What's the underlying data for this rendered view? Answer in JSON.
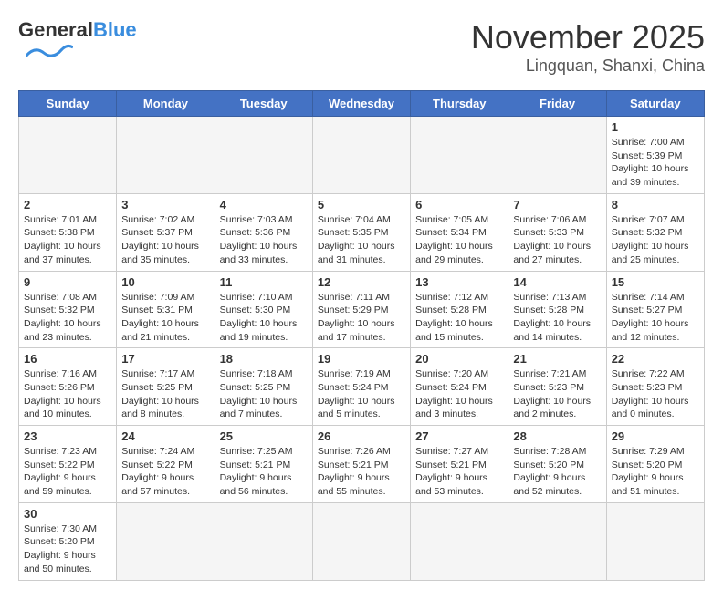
{
  "header": {
    "logo_general": "General",
    "logo_blue": "Blue",
    "month": "November 2025",
    "location": "Lingquan, Shanxi, China"
  },
  "weekdays": [
    "Sunday",
    "Monday",
    "Tuesday",
    "Wednesday",
    "Thursday",
    "Friday",
    "Saturday"
  ],
  "weeks": [
    [
      {
        "day": "",
        "info": ""
      },
      {
        "day": "",
        "info": ""
      },
      {
        "day": "",
        "info": ""
      },
      {
        "day": "",
        "info": ""
      },
      {
        "day": "",
        "info": ""
      },
      {
        "day": "",
        "info": ""
      },
      {
        "day": "1",
        "info": "Sunrise: 7:00 AM\nSunset: 5:39 PM\nDaylight: 10 hours and 39 minutes."
      }
    ],
    [
      {
        "day": "2",
        "info": "Sunrise: 7:01 AM\nSunset: 5:38 PM\nDaylight: 10 hours and 37 minutes."
      },
      {
        "day": "3",
        "info": "Sunrise: 7:02 AM\nSunset: 5:37 PM\nDaylight: 10 hours and 35 minutes."
      },
      {
        "day": "4",
        "info": "Sunrise: 7:03 AM\nSunset: 5:36 PM\nDaylight: 10 hours and 33 minutes."
      },
      {
        "day": "5",
        "info": "Sunrise: 7:04 AM\nSunset: 5:35 PM\nDaylight: 10 hours and 31 minutes."
      },
      {
        "day": "6",
        "info": "Sunrise: 7:05 AM\nSunset: 5:34 PM\nDaylight: 10 hours and 29 minutes."
      },
      {
        "day": "7",
        "info": "Sunrise: 7:06 AM\nSunset: 5:33 PM\nDaylight: 10 hours and 27 minutes."
      },
      {
        "day": "8",
        "info": "Sunrise: 7:07 AM\nSunset: 5:32 PM\nDaylight: 10 hours and 25 minutes."
      }
    ],
    [
      {
        "day": "9",
        "info": "Sunrise: 7:08 AM\nSunset: 5:32 PM\nDaylight: 10 hours and 23 minutes."
      },
      {
        "day": "10",
        "info": "Sunrise: 7:09 AM\nSunset: 5:31 PM\nDaylight: 10 hours and 21 minutes."
      },
      {
        "day": "11",
        "info": "Sunrise: 7:10 AM\nSunset: 5:30 PM\nDaylight: 10 hours and 19 minutes."
      },
      {
        "day": "12",
        "info": "Sunrise: 7:11 AM\nSunset: 5:29 PM\nDaylight: 10 hours and 17 minutes."
      },
      {
        "day": "13",
        "info": "Sunrise: 7:12 AM\nSunset: 5:28 PM\nDaylight: 10 hours and 15 minutes."
      },
      {
        "day": "14",
        "info": "Sunrise: 7:13 AM\nSunset: 5:28 PM\nDaylight: 10 hours and 14 minutes."
      },
      {
        "day": "15",
        "info": "Sunrise: 7:14 AM\nSunset: 5:27 PM\nDaylight: 10 hours and 12 minutes."
      }
    ],
    [
      {
        "day": "16",
        "info": "Sunrise: 7:16 AM\nSunset: 5:26 PM\nDaylight: 10 hours and 10 minutes."
      },
      {
        "day": "17",
        "info": "Sunrise: 7:17 AM\nSunset: 5:25 PM\nDaylight: 10 hours and 8 minutes."
      },
      {
        "day": "18",
        "info": "Sunrise: 7:18 AM\nSunset: 5:25 PM\nDaylight: 10 hours and 7 minutes."
      },
      {
        "day": "19",
        "info": "Sunrise: 7:19 AM\nSunset: 5:24 PM\nDaylight: 10 hours and 5 minutes."
      },
      {
        "day": "20",
        "info": "Sunrise: 7:20 AM\nSunset: 5:24 PM\nDaylight: 10 hours and 3 minutes."
      },
      {
        "day": "21",
        "info": "Sunrise: 7:21 AM\nSunset: 5:23 PM\nDaylight: 10 hours and 2 minutes."
      },
      {
        "day": "22",
        "info": "Sunrise: 7:22 AM\nSunset: 5:23 PM\nDaylight: 10 hours and 0 minutes."
      }
    ],
    [
      {
        "day": "23",
        "info": "Sunrise: 7:23 AM\nSunset: 5:22 PM\nDaylight: 9 hours and 59 minutes."
      },
      {
        "day": "24",
        "info": "Sunrise: 7:24 AM\nSunset: 5:22 PM\nDaylight: 9 hours and 57 minutes."
      },
      {
        "day": "25",
        "info": "Sunrise: 7:25 AM\nSunset: 5:21 PM\nDaylight: 9 hours and 56 minutes."
      },
      {
        "day": "26",
        "info": "Sunrise: 7:26 AM\nSunset: 5:21 PM\nDaylight: 9 hours and 55 minutes."
      },
      {
        "day": "27",
        "info": "Sunrise: 7:27 AM\nSunset: 5:21 PM\nDaylight: 9 hours and 53 minutes."
      },
      {
        "day": "28",
        "info": "Sunrise: 7:28 AM\nSunset: 5:20 PM\nDaylight: 9 hours and 52 minutes."
      },
      {
        "day": "29",
        "info": "Sunrise: 7:29 AM\nSunset: 5:20 PM\nDaylight: 9 hours and 51 minutes."
      }
    ],
    [
      {
        "day": "30",
        "info": "Sunrise: 7:30 AM\nSunset: 5:20 PM\nDaylight: 9 hours and 50 minutes."
      },
      {
        "day": "",
        "info": ""
      },
      {
        "day": "",
        "info": ""
      },
      {
        "day": "",
        "info": ""
      },
      {
        "day": "",
        "info": ""
      },
      {
        "day": "",
        "info": ""
      },
      {
        "day": "",
        "info": ""
      }
    ]
  ]
}
